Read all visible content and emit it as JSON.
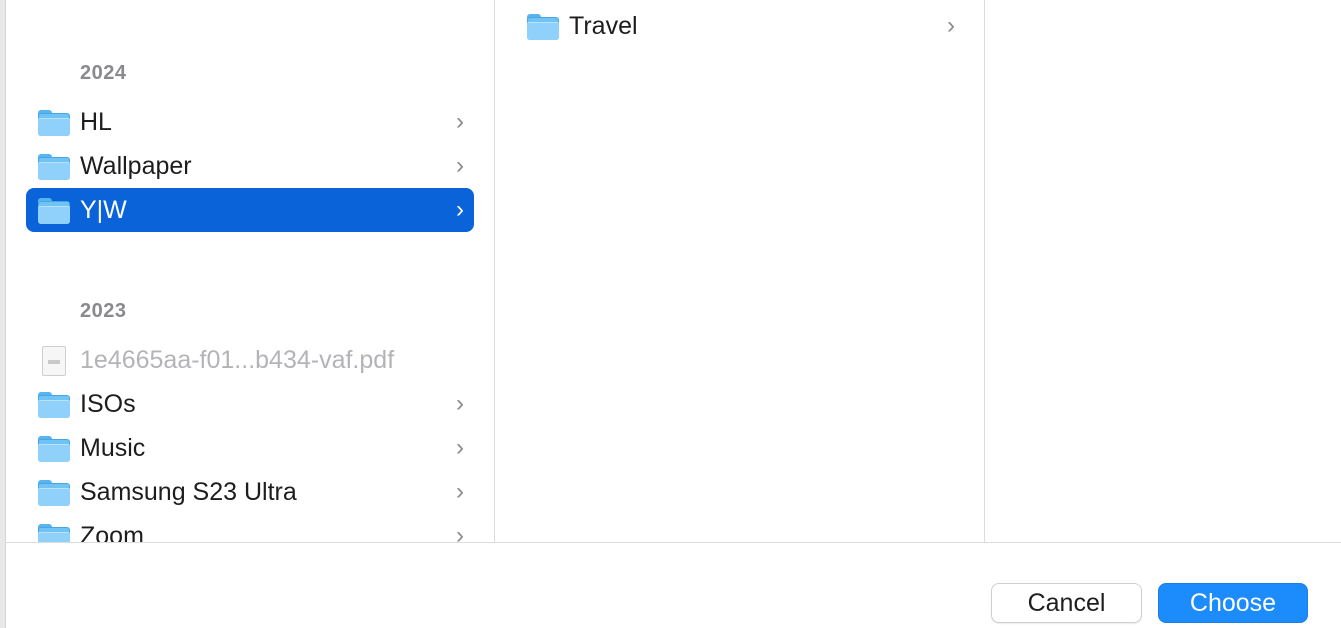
{
  "column1": {
    "groups": [
      {
        "header": "2024",
        "items": [
          {
            "label": "HL",
            "type": "folder",
            "chevron": "›"
          },
          {
            "label": "Wallpaper",
            "type": "folder",
            "chevron": "›"
          },
          {
            "label": "Y|W",
            "type": "folder",
            "chevron": "›",
            "selected": true
          }
        ]
      },
      {
        "header": "2023",
        "items": [
          {
            "label": "1e4665aa-f01...b434-vaf.pdf",
            "type": "pdf",
            "disabled": true
          },
          {
            "label": "ISOs",
            "type": "folder",
            "chevron": "›"
          },
          {
            "label": "Music",
            "type": "folder",
            "chevron": "›"
          },
          {
            "label": "Samsung S23 Ultra",
            "type": "folder",
            "chevron": "›"
          },
          {
            "label": "Zoom",
            "type": "folder",
            "chevron": "›"
          }
        ]
      }
    ]
  },
  "column2": {
    "items": [
      {
        "label": "Travel",
        "type": "folder",
        "chevron": "›"
      }
    ]
  },
  "footer": {
    "cancel_label": "Cancel",
    "choose_label": "Choose"
  },
  "colors": {
    "selection": "#0a63d9",
    "primary_button": "#1c8bfb",
    "folder": "#6fc3f5"
  }
}
